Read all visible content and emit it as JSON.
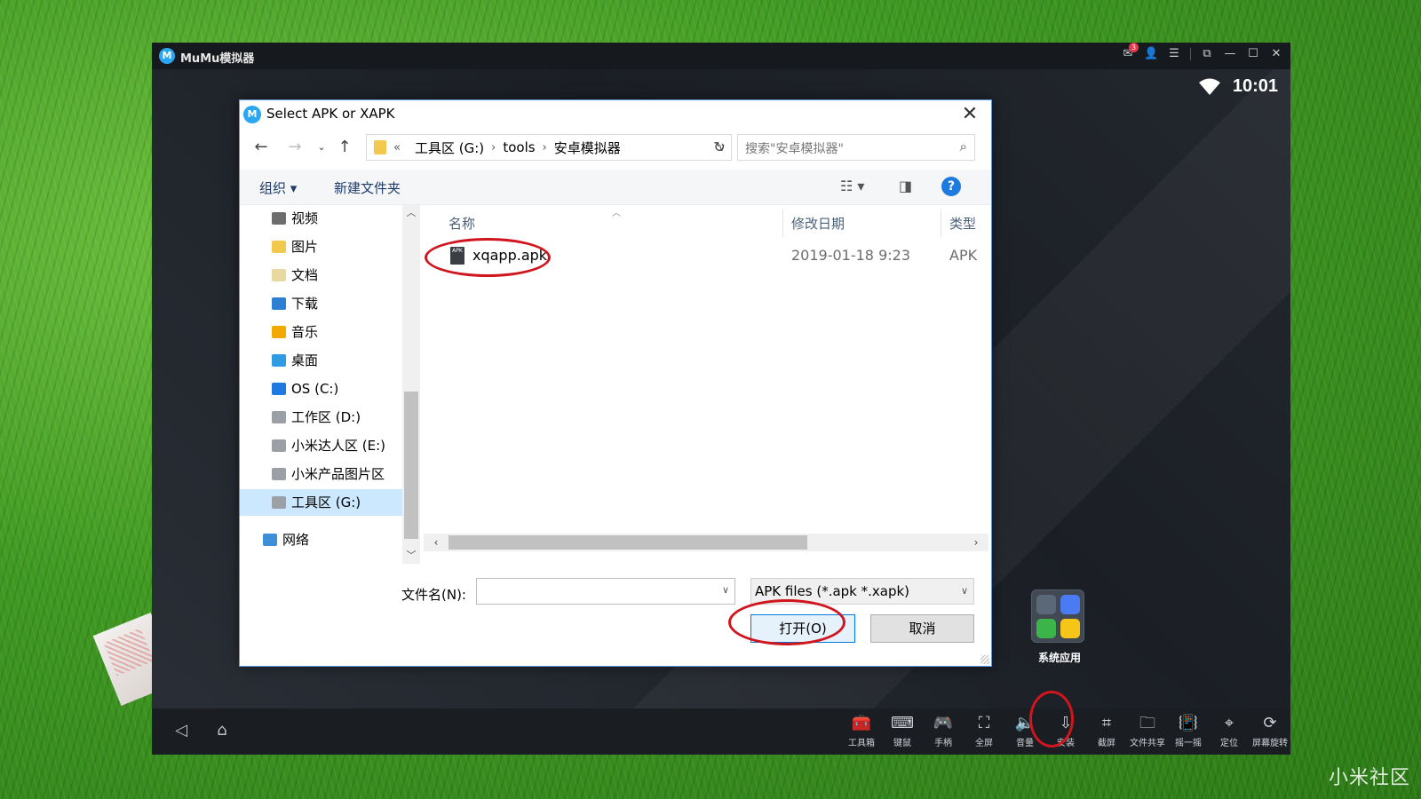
{
  "emulator": {
    "title": "MuMu模拟器",
    "notification_count": "3",
    "time": "10:01",
    "system_apps_label": "系统应用",
    "toolbar": [
      {
        "label": "工具箱",
        "icon": "toolbox-icon"
      },
      {
        "label": "键鼠",
        "icon": "keyboard-icon"
      },
      {
        "label": "手柄",
        "icon": "gamepad-icon"
      },
      {
        "label": "全屏",
        "icon": "fullscreen-icon"
      },
      {
        "label": "音量",
        "icon": "volume-icon"
      },
      {
        "label": "安装",
        "icon": "apk-install-icon"
      },
      {
        "label": "截屏",
        "icon": "crop-icon"
      },
      {
        "label": "文件共享",
        "icon": "folder-icon"
      },
      {
        "label": "摇一摇",
        "icon": "shake-icon"
      },
      {
        "label": "定位",
        "icon": "location-icon"
      },
      {
        "label": "屏幕旋转",
        "icon": "rotate-icon"
      }
    ]
  },
  "dialog": {
    "title": "Select APK or XAPK",
    "breadcrumb": [
      "工具区 (G:)",
      "tools",
      "安卓模拟器"
    ],
    "breadcrumb_prefix": "«",
    "search_placeholder": "搜索\"安卓模拟器\"",
    "organize_label": "组织 ▾",
    "new_folder_label": "新建文件夹",
    "nav_items": [
      {
        "label": "视频",
        "color": "#6d6d6d"
      },
      {
        "label": "图片",
        "color": "#f2c94c"
      },
      {
        "label": "文档",
        "color": "#e8d9a0"
      },
      {
        "label": "下载",
        "color": "#2d7fd3"
      },
      {
        "label": "音乐",
        "color": "#f2a900"
      },
      {
        "label": "桌面",
        "color": "#2f9be3"
      },
      {
        "label": "OS (C:)",
        "color": "#1f7ae0"
      },
      {
        "label": "工作区 (D:)",
        "color": "#9aa0a6"
      },
      {
        "label": "小米达人区 (E:)",
        "color": "#9aa0a6"
      },
      {
        "label": "小米产品图片区",
        "color": "#9aa0a6"
      },
      {
        "label": "工具区 (G:)",
        "color": "#9aa0a6"
      },
      {
        "label": "网络",
        "color": "#3d8fd8"
      }
    ],
    "columns": {
      "name": "名称",
      "date": "修改日期",
      "type": "类型"
    },
    "files": [
      {
        "name": "xqapp.apk",
        "date": "2019-01-18 9:23",
        "type": "APK",
        "icon_text": "APK"
      }
    ],
    "filename_label": "文件名(N):",
    "filename_value": "",
    "filter_label": "APK files (*.apk *.xapk)",
    "open_label": "打开(O)",
    "cancel_label": "取消"
  },
  "watermark": "小米社区"
}
